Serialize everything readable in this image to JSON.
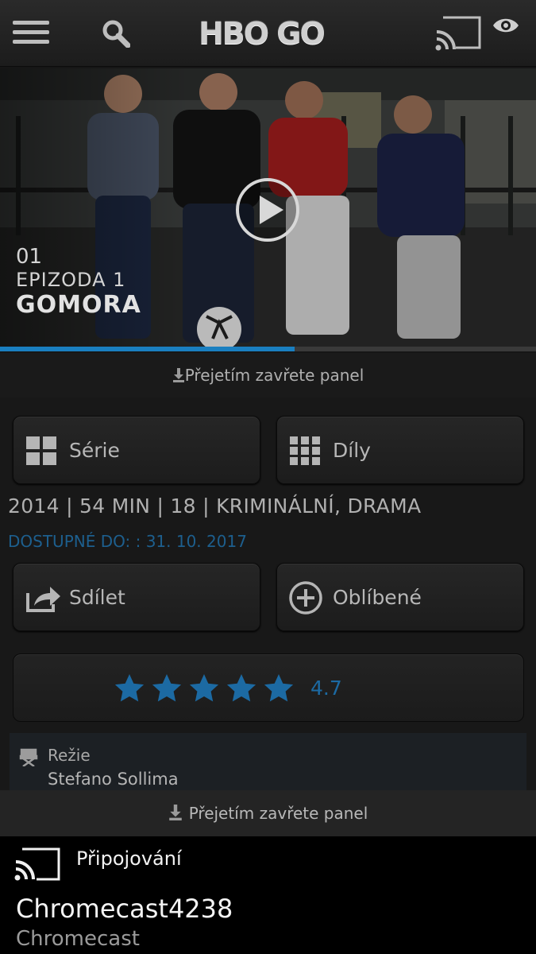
{
  "topbar": {
    "menu_icon": "hamburger-menu-icon",
    "search_icon": "search-icon",
    "logo_text": "HBO GO",
    "cast_icon": "cast-icon",
    "eye_icon": "eye-icon"
  },
  "hero": {
    "episode_number": "01",
    "episode_label": "EPIZODA 1",
    "title": "GOMORA",
    "play_icon": "play-icon",
    "progress": 0.55,
    "progress_color": "#1a7fc0"
  },
  "panel_hint_top": "Přejetím zavřete panel",
  "buttons": {
    "series": "Série",
    "episodes": "Díly",
    "share": "Sdílet",
    "favorites": "Oblíbené"
  },
  "meta": {
    "info": "2014 | 54 MIN | 18 | KRIMINÁLNÍ, DRAMA",
    "available": "DOSTUPNÉ DO: : 31. 10. 2017"
  },
  "rating": {
    "stars": 5,
    "value": "4.7",
    "color": "#1c6aa3"
  },
  "director": {
    "label": "Režie",
    "name": "Stefano Sollima",
    "icon": "director-chair-icon"
  },
  "panel_hint_bottom": "Přejetím zavřete panel",
  "cast_sheet": {
    "status": "Připojování",
    "device_name": "Chromecast4238",
    "device_type": "Chromecast"
  }
}
